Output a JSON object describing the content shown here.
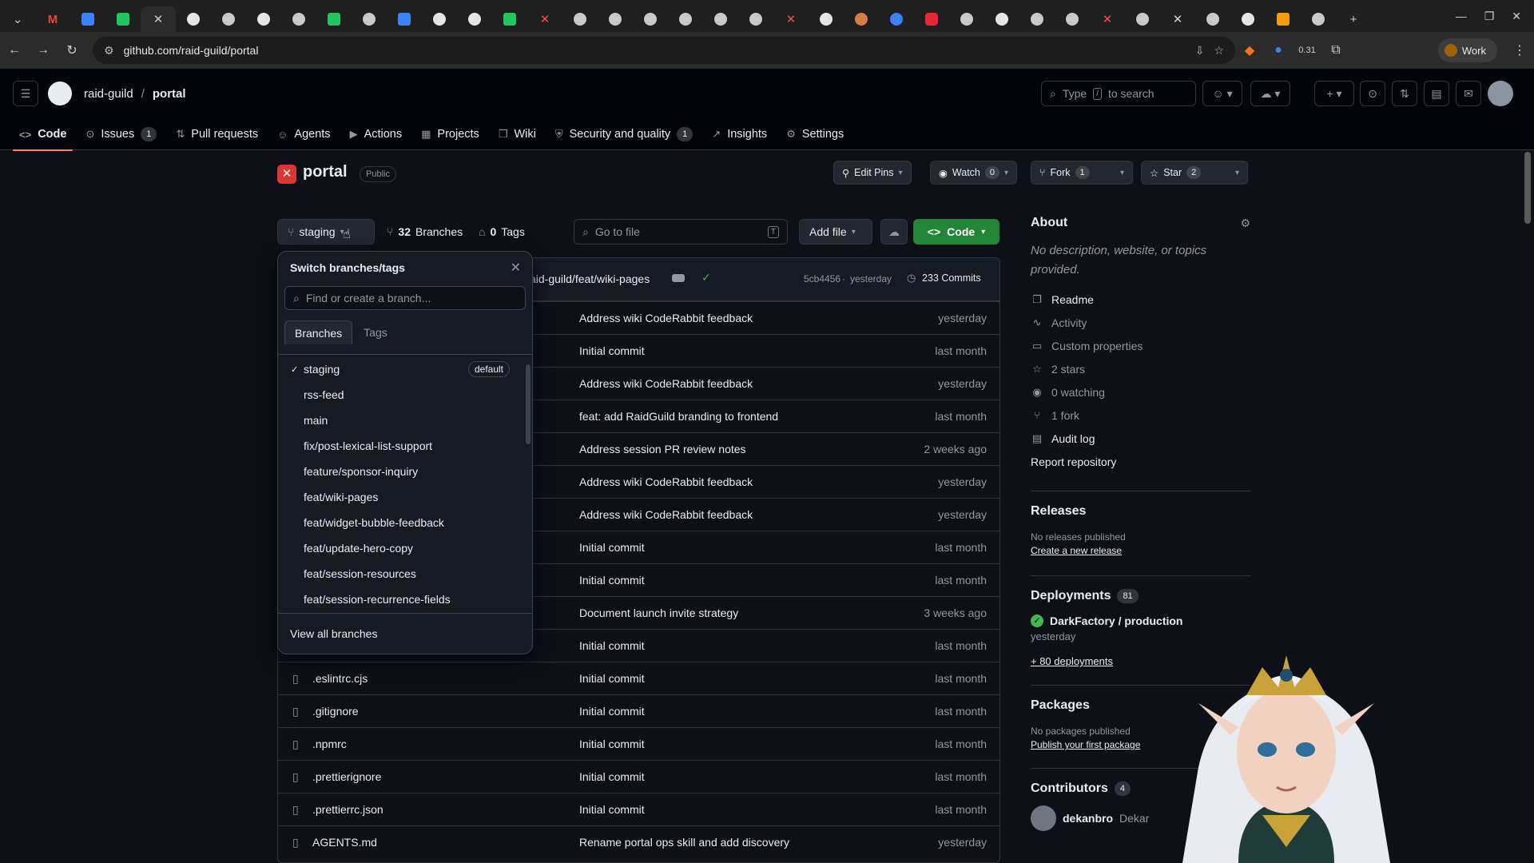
{
  "browser": {
    "url": "github.com/raid-guild/portal",
    "profile_label": "Work",
    "extension_badge": "0.31",
    "tab_favicons": [
      "chevron-down",
      "gmail",
      "blue",
      "green",
      "close",
      "github",
      "circle",
      "github",
      "circle",
      "green-triangle",
      "x-black",
      "blue",
      "github",
      "github",
      "green",
      "x-red",
      "circle",
      "circle",
      "circle",
      "circle",
      "circle",
      "circle",
      "x-red",
      "github",
      "orange",
      "blue-ring",
      "red",
      "circle",
      "github",
      "circle",
      "circle",
      "x-red",
      "circle",
      "x",
      "circle",
      "github",
      "d",
      "circle",
      "plus"
    ]
  },
  "header": {
    "owner": "raid-guild",
    "separator": "/",
    "repo": "portal",
    "search_placeholder_pre": "Type",
    "search_key": "/",
    "search_placeholder_post": "to search"
  },
  "repo_nav": [
    {
      "label": "Code",
      "icon": "code-icon",
      "active": true
    },
    {
      "label": "Issues",
      "icon": "issue-icon",
      "count": "1"
    },
    {
      "label": "Pull requests",
      "icon": "pull-request-icon"
    },
    {
      "label": "Agents",
      "icon": "agents-icon"
    },
    {
      "label": "Actions",
      "icon": "play-icon"
    },
    {
      "label": "Projects",
      "icon": "table-icon"
    },
    {
      "label": "Wiki",
      "icon": "book-icon"
    },
    {
      "label": "Security and quality",
      "icon": "shield-icon",
      "count": "1"
    },
    {
      "label": "Insights",
      "icon": "graph-icon"
    },
    {
      "label": "Settings",
      "icon": "gear-icon"
    }
  ],
  "repo": {
    "icon_letter": "✕",
    "name": "portal",
    "visibility": "Public",
    "edit_pins": "Edit Pins",
    "watch": "Watch",
    "watch_count": "0",
    "fork": "Fork",
    "fork_count": "1",
    "star": "Star",
    "star_count": "2"
  },
  "filenav": {
    "branch": "staging",
    "branches_count": "32",
    "branches_label": "Branches",
    "tags_count": "0",
    "tags_label": "Tags",
    "goto_placeholder": "Go to file",
    "goto_key": "T",
    "add_file": "Add file",
    "code": "Code"
  },
  "commit_bar": {
    "author_path": "aid-guild/feat/wiki-pages",
    "hash": "5cb4456",
    "sep": "·",
    "when": "yesterday",
    "commits_label": "233 Commits"
  },
  "files": [
    {
      "name": "",
      "message": "Address wiki CodeRabbit feedback",
      "date": "yesterday"
    },
    {
      "name": "",
      "message": "Initial commit",
      "date": "last month"
    },
    {
      "name": "",
      "message": "Address wiki CodeRabbit feedback",
      "date": "yesterday"
    },
    {
      "name": "",
      "message": "feat: add RaidGuild branding to frontend",
      "date": "last month"
    },
    {
      "name": "",
      "message": "Address session PR review notes",
      "date": "2 weeks ago"
    },
    {
      "name": "",
      "message": "Address wiki CodeRabbit feedback",
      "date": "yesterday"
    },
    {
      "name": "",
      "message": "Address wiki CodeRabbit feedback",
      "date": "yesterday"
    },
    {
      "name": "",
      "message": "Initial commit",
      "date": "last month"
    },
    {
      "name": "",
      "message": "Initial commit",
      "date": "last month"
    },
    {
      "name": "",
      "message": "Document launch invite strategy",
      "date": "3 weeks ago"
    },
    {
      "name": "",
      "message": "Initial commit",
      "date": "last month"
    },
    {
      "name": ".eslintrc.cjs",
      "message": "Initial commit",
      "date": "last month"
    },
    {
      "name": ".gitignore",
      "message": "Initial commit",
      "date": "last month"
    },
    {
      "name": ".npmrc",
      "message": "Initial commit",
      "date": "last month"
    },
    {
      "name": ".prettierignore",
      "message": "Initial commit",
      "date": "last month"
    },
    {
      "name": ".prettierrc.json",
      "message": "Initial commit",
      "date": "last month"
    },
    {
      "name": "AGENTS.md",
      "message": "Rename portal ops skill and add discovery",
      "date": "yesterday"
    }
  ],
  "branch_dropdown": {
    "title": "Switch branches/tags",
    "filter_placeholder": "Find or create a branch...",
    "tab_branches": "Branches",
    "tab_tags": "Tags",
    "default_label": "default",
    "branches": [
      "staging",
      "rss-feed",
      "main",
      "fix/post-lexical-list-support",
      "feature/sponsor-inquiry",
      "feat/wiki-pages",
      "feat/widget-bubble-feedback",
      "feat/update-hero-copy",
      "feat/session-resources",
      "feat/session-recurrence-fields"
    ],
    "footer": "View all branches"
  },
  "about": {
    "title": "About",
    "description": "No description, website, or topics provided.",
    "links": [
      {
        "label": "Readme",
        "icon": "book-icon",
        "highlight": true
      },
      {
        "label": "Activity",
        "icon": "pulse-icon"
      },
      {
        "label": "Custom properties",
        "icon": "note-icon"
      },
      {
        "label": "2 stars",
        "icon": "star-icon"
      },
      {
        "label": "0 watching",
        "icon": "eye-icon"
      },
      {
        "label": "1 fork",
        "icon": "fork-icon"
      },
      {
        "label": "Audit log",
        "icon": "log-icon",
        "highlight": true
      }
    ],
    "report": "Report repository"
  },
  "releases": {
    "title": "Releases",
    "empty": "No releases published",
    "create": "Create a new release"
  },
  "deployments": {
    "title": "Deployments",
    "count": "81",
    "env": "DarkFactory / production",
    "when": "yesterday",
    "more": "+ 80 deployments"
  },
  "packages": {
    "title": "Packages",
    "empty": "No packages published",
    "publish": "Publish your first package"
  },
  "contributors": {
    "title": "Contributors",
    "count": "4",
    "first": "dekanbro",
    "first_extra": "Dekar"
  }
}
